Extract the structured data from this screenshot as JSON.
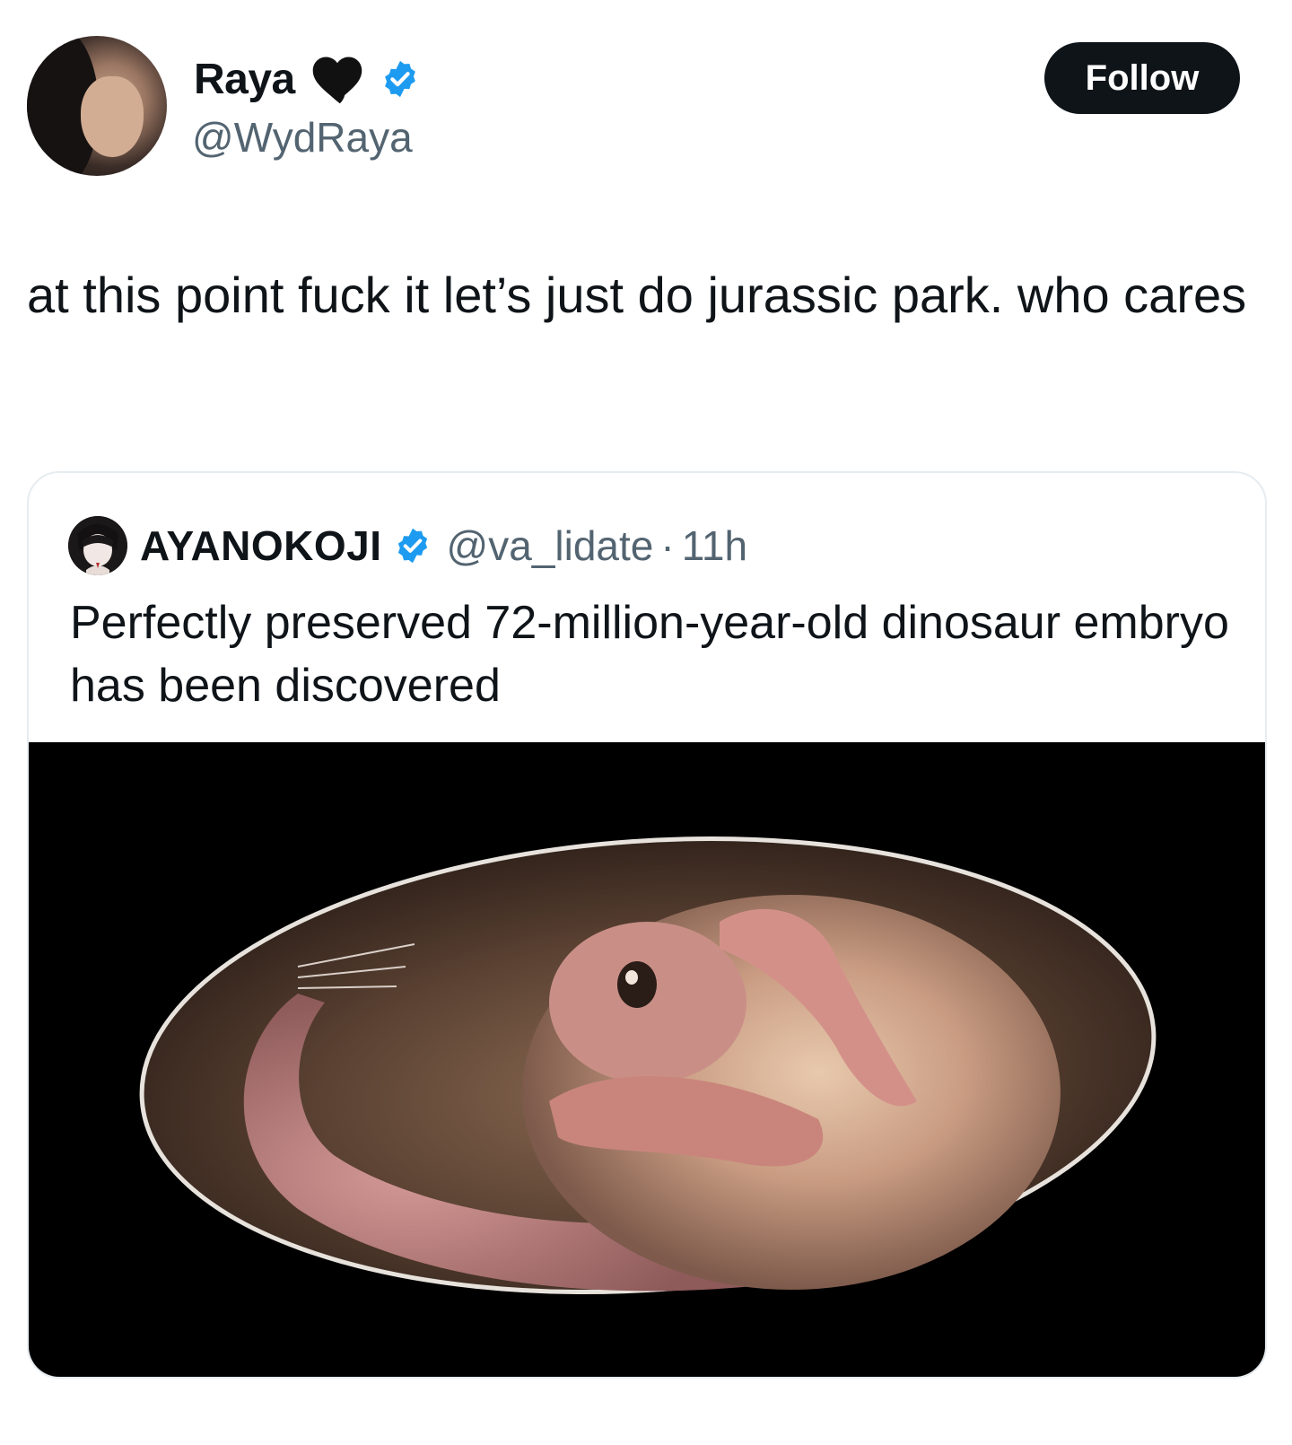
{
  "author": {
    "display_name": "Raya",
    "handle": "@WydRaya",
    "emoji": "black-heart",
    "verified": true
  },
  "follow_label": "Follow",
  "tweet_text": "at this point fuck it let’s just do jurassic park. who cares",
  "quoted": {
    "display_name": "AYANOKOJI",
    "handle": "@va_lidate",
    "separator": "·",
    "time": "11h",
    "verified": true,
    "text": "Perfectly preserved 72-million-year-old dinosaur embryo has been discovered"
  },
  "colors": {
    "verified_blue": "#1d9bf0",
    "follow_bg": "#0f1419",
    "secondary_text": "#536471"
  }
}
